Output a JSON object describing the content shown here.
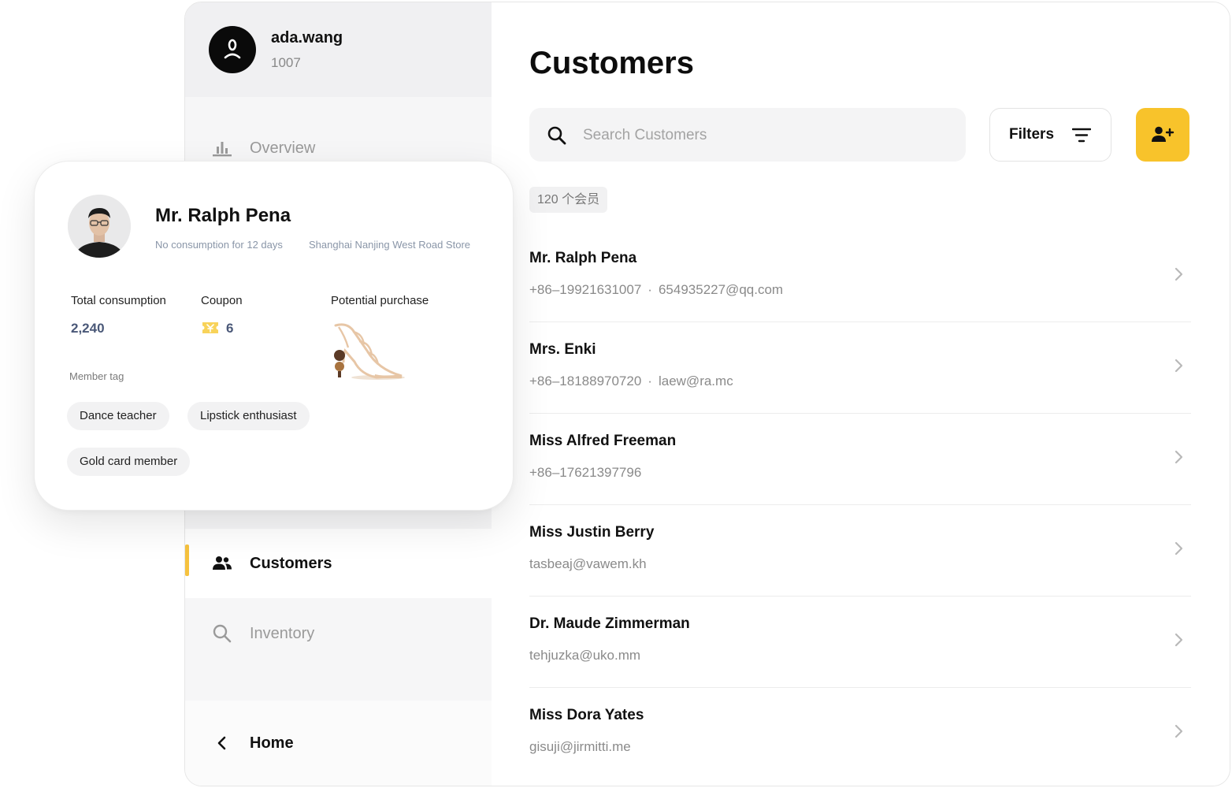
{
  "user": {
    "name": "ada.wang",
    "id": "1007"
  },
  "nav": {
    "overview": "Overview",
    "customers": "Customers",
    "inventory": "Inventory",
    "home": "Home"
  },
  "main": {
    "title": "Customers",
    "search_placeholder": "Search Customers",
    "filters_label": "Filters",
    "member_count": "120 个会员"
  },
  "customers": [
    {
      "name": "Mr. Ralph Pena",
      "phone": "+86–19921631007",
      "email": "654935227@qq.com"
    },
    {
      "name": "Mrs. Enki",
      "phone": "+86–18188970720",
      "email": "laew@ra.mc"
    },
    {
      "name": "Miss Alfred Freeman",
      "phone": "+86–17621397796",
      "email": ""
    },
    {
      "name": "Miss Justin Berry",
      "phone": "",
      "email": "tasbeaj@vawem.kh"
    },
    {
      "name": "Dr. Maude Zimmerman",
      "phone": "",
      "email": "tehjuzka@uko.mm"
    },
    {
      "name": "Miss Dora Yates",
      "phone": "",
      "email": "gisuji@jirmitti.me"
    }
  ],
  "profile": {
    "name": "Mr. Ralph Pena",
    "no_consumption": "No consumption for 12 days",
    "store": "Shanghai Nanjing West Road Store",
    "total_label": "Total consumption",
    "total_value": "2,240",
    "coupon_label": "Coupon",
    "coupon_value": "6",
    "potential_label": "Potential purchase",
    "tag_title": "Member tag",
    "tags": [
      "Dance teacher",
      "Lipstick enthusiast",
      "Gold card member"
    ]
  },
  "colors": {
    "accent": "#f8c32b",
    "active_bar": "#f6c23e",
    "stat_value": "#4a5878"
  },
  "icons": {
    "overview": "bar-chart-icon",
    "customers": "users-icon",
    "inventory": "search-icon",
    "home": "chevron-left-icon",
    "filters": "filter-lines-icon",
    "add": "add-user-icon",
    "row": "chevron-right-icon",
    "coupon": "coupon-ticket-icon"
  }
}
